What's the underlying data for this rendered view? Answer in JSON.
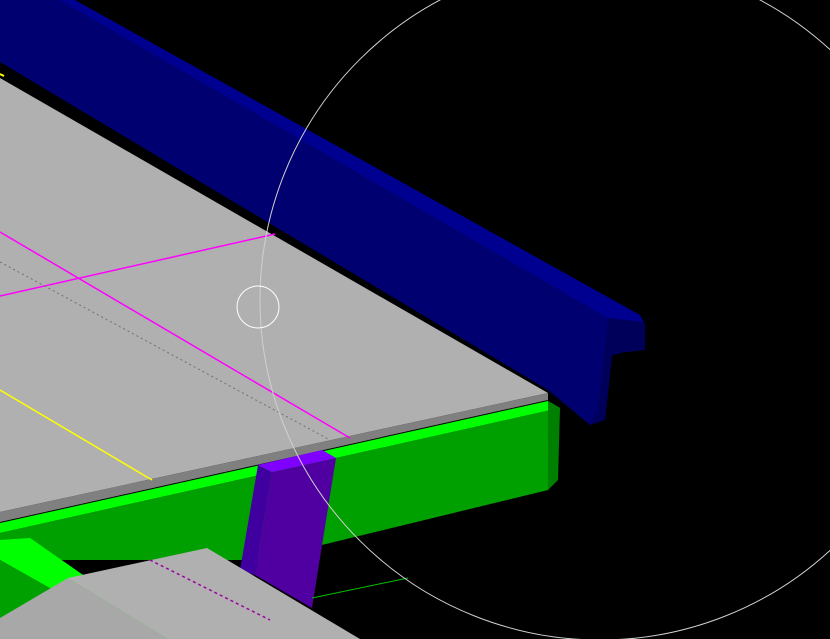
{
  "viewport": {
    "background": "#000000",
    "view_type": "3d-cad-model-view",
    "cursor": "orbit-cursor"
  },
  "model": {
    "colors": {
      "slab_top": "#b0b0b0",
      "slab_edge": "#808080",
      "beam_top": "#00ff00",
      "beam_face": "#00a000",
      "upper_beam_top": "#000090",
      "upper_beam_face": "#000070",
      "column_face": "#5000a0",
      "column_top": "#8000ff",
      "grid_line": "#ff00ff",
      "guide_line": "#ffff00",
      "orbit_circle": "#d0d0d0",
      "axis_line": "#00ff00"
    }
  }
}
